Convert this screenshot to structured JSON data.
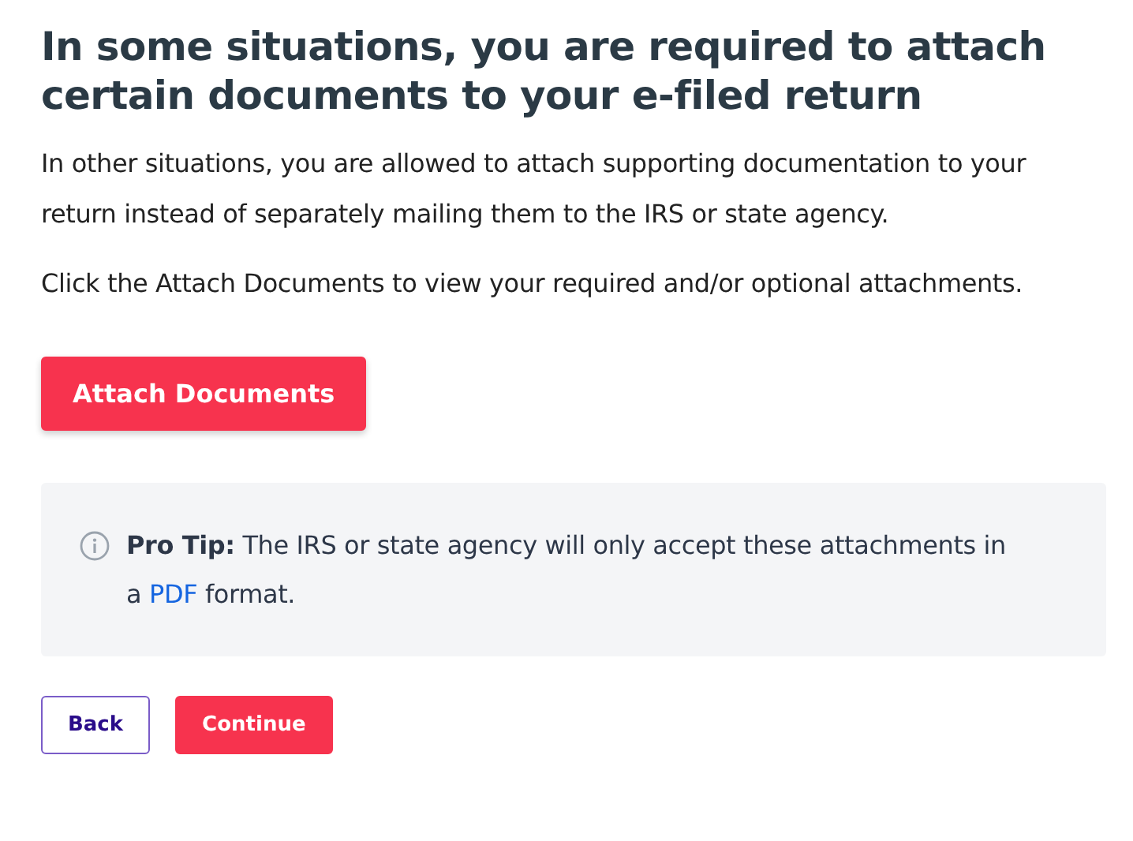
{
  "heading": "In some situations, you are required to attach certain documents to your e-filed return",
  "paragraphs": [
    "In other situations, you are allowed to attach supporting documentation to your return instead of separately mailing them to the IRS or state agency.",
    "Click the Attach Documents to view your required and/or optional attachments."
  ],
  "attach_button": "Attach Documents",
  "tip": {
    "text_before": "**Pro Tip:** The IRS or state agency will only accept these attachments in a",
    "link": "PDF",
    "text_after": "format."
  },
  "buttons": [
    {
      "label": "Back",
      "kind": "secondary"
    },
    {
      "label": "Continue",
      "kind": "primary"
    }
  ]
}
